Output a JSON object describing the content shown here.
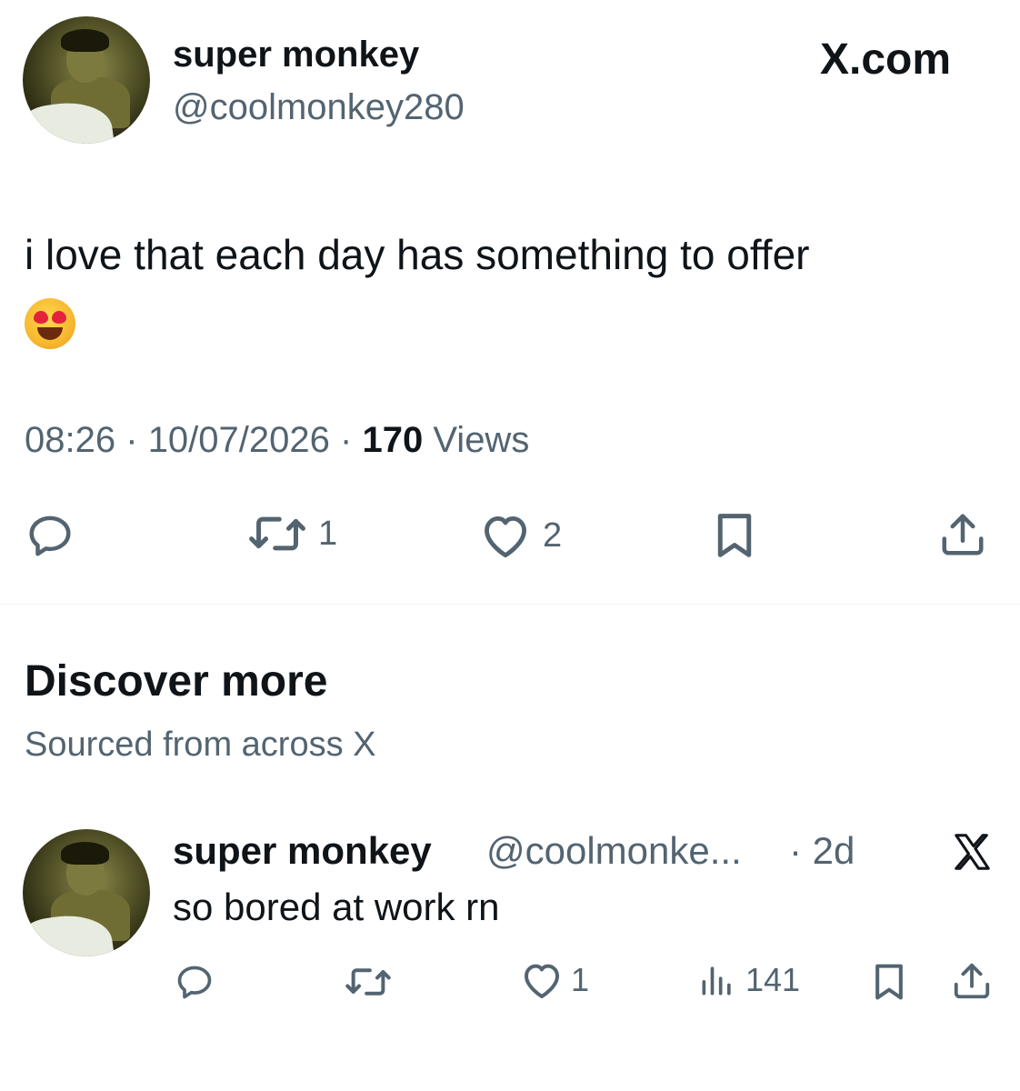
{
  "tweet": {
    "author_name": "super monkey",
    "author_handle": "@coolmonkey280",
    "brand": "X.com",
    "text": "i love that each day has something to offer",
    "emoji": "smiling-face-with-heart-eyes",
    "time": "08:26",
    "date": "10/07/2026",
    "separator": "·",
    "views_count": "170",
    "views_label": "Views",
    "actions": {
      "reply_count": "",
      "repost_count": "1",
      "like_count": "2"
    }
  },
  "discover": {
    "title": "Discover more",
    "subtitle": "Sourced from across X"
  },
  "related_post": {
    "author_name": "super monkey",
    "author_handle": "@coolmonke...",
    "age": "· 2d",
    "text": "so bored at work rn",
    "actions": {
      "reply_count": "",
      "repost_count": "",
      "like_count": "1",
      "views_count": "141"
    }
  },
  "colors": {
    "text_primary": "#0f1419",
    "text_secondary": "#536471",
    "divider": "#eff3f4"
  }
}
